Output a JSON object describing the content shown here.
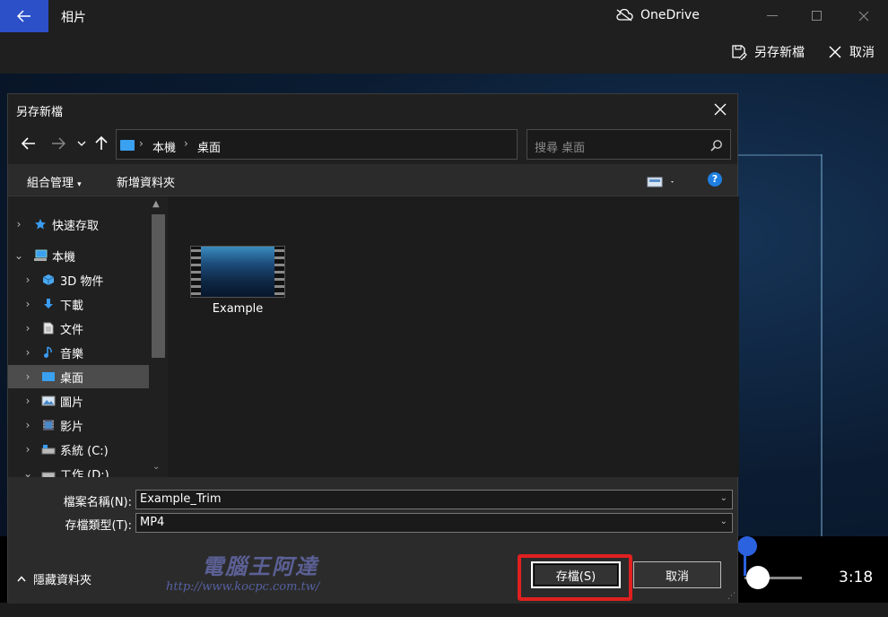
{
  "app": {
    "title": "相片",
    "onedrive_label": "OneDrive",
    "toolbar": {
      "save_as_label": "另存新檔",
      "cancel_label": "取消"
    },
    "player": {
      "end_time": "3:18"
    },
    "colors": {
      "accent": "#2b50c8",
      "trim_handle": "#2b62e0"
    }
  },
  "dialog": {
    "title": "另存新檔",
    "address": {
      "crumbs": [
        "本機",
        "桌面"
      ]
    },
    "search_placeholder": "搜尋 桌面",
    "commands": {
      "organize": "組合管理",
      "new_folder": "新增資料夾"
    },
    "nav_items": [
      {
        "label": "快速存取",
        "icon": "star-icon"
      },
      {
        "label": "本機",
        "icon": "computer-icon"
      },
      {
        "label": "3D 物件",
        "icon": "3d-objects-icon"
      },
      {
        "label": "下載",
        "icon": "download-icon"
      },
      {
        "label": "文件",
        "icon": "document-icon"
      },
      {
        "label": "音樂",
        "icon": "music-icon"
      },
      {
        "label": "桌面",
        "icon": "desktop-icon",
        "selected": true
      },
      {
        "label": "圖片",
        "icon": "pictures-icon"
      },
      {
        "label": "影片",
        "icon": "videos-icon"
      },
      {
        "label": "系統 (C:)",
        "icon": "drive-icon"
      },
      {
        "label": "工作 (D:)",
        "icon": "drive-icon"
      }
    ],
    "files": [
      {
        "name": "Example",
        "type": "video"
      }
    ],
    "filename_label": "檔案名稱(N):",
    "filename_value": "Example_Trim",
    "filetype_label": "存檔類型(T):",
    "filetype_value": "MP4",
    "hide_folders_label": "隱藏資料夾",
    "save_button": "存檔(S)",
    "cancel_button": "取消",
    "colors": {
      "highlight": "#e02020",
      "selected_row": "#4c4c4c",
      "help": "#1e7fe0"
    }
  },
  "watermark": {
    "name": "電腦王阿達",
    "url": "http://www.kocpc.com.tw/"
  }
}
